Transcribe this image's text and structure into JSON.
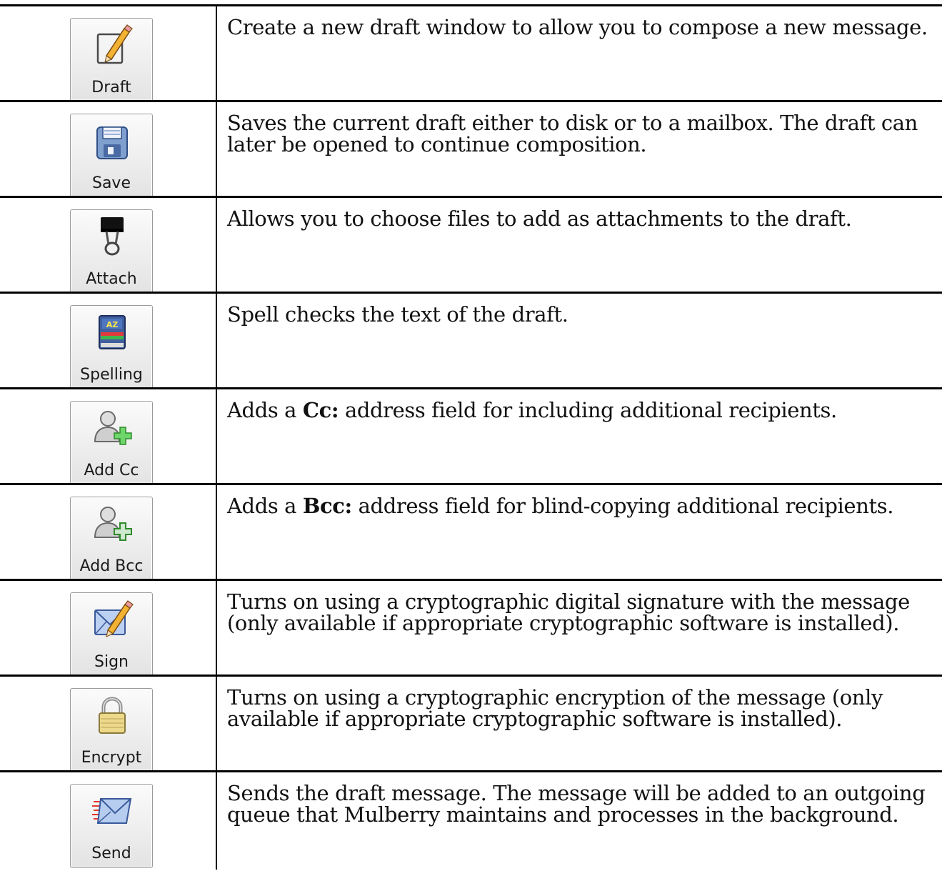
{
  "rows": [
    {
      "label": "Draft",
      "icon": "pencil-paper-icon",
      "desc": "Create a new draft window to allow you to compose a new message."
    },
    {
      "label": "Save",
      "icon": "floppy-disk-icon",
      "desc": "Saves the current draft either to disk or to a mailbox. The draft can later be opened to continue composition."
    },
    {
      "label": "Attach",
      "icon": "binder-clip-icon",
      "desc": "Allows you to choose files to add as attachments to the draft."
    },
    {
      "label": "Spelling",
      "icon": "spell-book-icon",
      "desc": "Spell checks the text of the draft."
    },
    {
      "label": "Add Cc",
      "icon": "person-plus-icon",
      "desc_before": "Adds a ",
      "desc_bold": "Cc:",
      "desc_after": " address field for including additional recipients."
    },
    {
      "label": "Add Bcc",
      "icon": "person-plus-outline-icon",
      "desc_before": "Adds a ",
      "desc_bold": "Bcc:",
      "desc_after": " address field for blind-copying additional recipients."
    },
    {
      "label": "Sign",
      "icon": "envelope-pencil-icon",
      "desc": "Turns on using a cryptographic digital signature with the message (only available if appropriate cryptographic software is installed)."
    },
    {
      "label": "Encrypt",
      "icon": "padlock-icon",
      "desc": "Turns on using a cryptographic encryption of the message (only available if appropriate cryptographic software is installed)."
    },
    {
      "label": "Send",
      "icon": "send-envelope-icon",
      "desc": "Sends the draft message. The message will be added to an outgoing queue that Mulberry maintains and processes in the background."
    }
  ]
}
